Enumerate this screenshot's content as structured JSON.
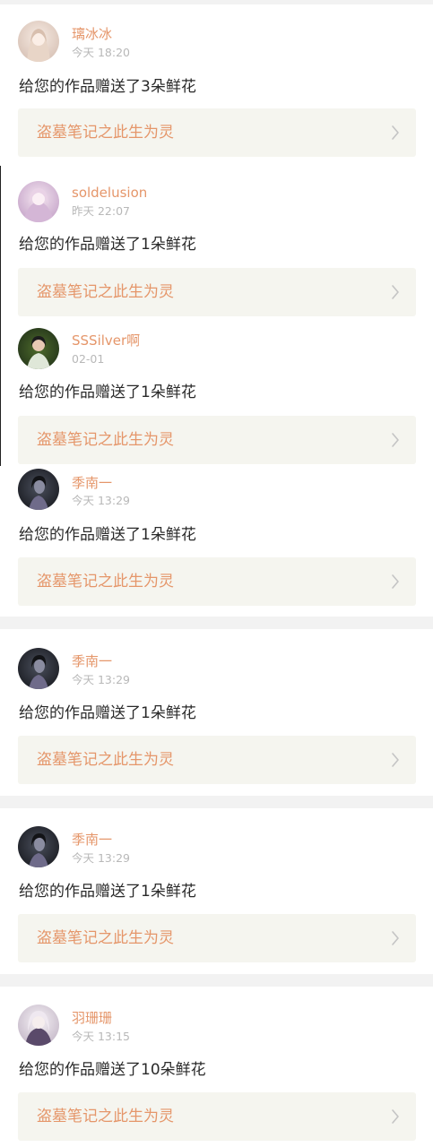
{
  "notifications": [
    {
      "username": "璃冰冰",
      "time": "今天 18:20",
      "message": "给您的作品赠送了3朵鲜花",
      "work_title": "盗墓笔记之此生为灵",
      "avatar": "avatar-anime-girl-light"
    },
    {
      "username": "soldelusion",
      "time": "昨天 22:07",
      "message": "给您的作品赠送了1朵鲜花",
      "work_title": "盗墓笔记之此生为灵",
      "avatar": "avatar-anime-girl-pink"
    },
    {
      "username": "SSSilver啊",
      "time": "02-01",
      "message": "给您的作品赠送了1朵鲜花",
      "work_title": "盗墓笔记之此生为灵",
      "avatar": "avatar-photo-green"
    },
    {
      "username": "季南一",
      "time": "今天 13:29",
      "message": "给您的作品赠送了1朵鲜花",
      "work_title": "盗墓笔记之此生为灵",
      "avatar": "avatar-dark-portrait"
    },
    {
      "username": "季南一",
      "time": "今天 13:29",
      "message": "给您的作品赠送了1朵鲜花",
      "work_title": "盗墓笔记之此生为灵",
      "avatar": "avatar-dark-portrait"
    },
    {
      "username": "季南一",
      "time": "今天 13:29",
      "message": "给您的作品赠送了1朵鲜花",
      "work_title": "盗墓笔记之此生为灵",
      "avatar": "avatar-dark-portrait"
    },
    {
      "username": "羽珊珊",
      "time": "今天 13:15",
      "message": "给您的作品赠送了10朵鲜花",
      "work_title": "盗墓笔记之此生为灵",
      "avatar": "avatar-anime-girl-white"
    }
  ],
  "colors": {
    "accent": "#e5966a",
    "link_background": "#f5f5ef",
    "separator": "#f2f2f2",
    "time_text": "#b8b8b8",
    "message_text": "#2a2a2a"
  },
  "icons": {
    "chevron": "chevron-right-icon"
  }
}
